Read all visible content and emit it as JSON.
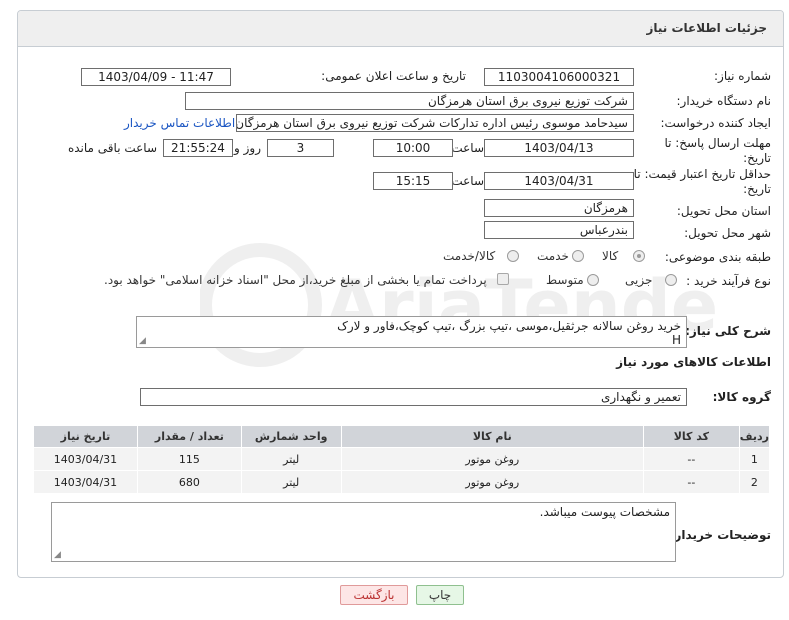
{
  "header": {
    "title": "جزئیات اطلاعات نیاز"
  },
  "fields": {
    "need_number_label": "شماره نیاز:",
    "need_number": "1103004106000321",
    "announce_label": "تاریخ و ساعت اعلان عمومی:",
    "announce_value": "1403/04/09 - 11:47",
    "buyer_label": "نام دستگاه خریدار:",
    "buyer_value": "شرکت توزیع نیروی برق استان هرمزگان",
    "creator_label": "ایجاد کننده درخواست:",
    "creator_value": "سیدحامد موسوی رئیس اداره تدارکات شرکت توزیع نیروی برق استان هرمزگان",
    "contact_link": "اطلاعات تماس خریدار",
    "reply_deadline_label": "مهلت ارسال پاسخ: تا تاریخ:",
    "reply_date": "1403/04/13",
    "time_label": "ساعت",
    "reply_time": "10:00",
    "days_value": "3",
    "days_label": "روز و",
    "remaining_time": "21:55:24",
    "remaining_label": "ساعت باقی مانده",
    "price_validity_label": "حداقل تاریخ اعتبار قیمت: تا تاریخ:",
    "price_date": "1403/04/31",
    "price_time": "15:15",
    "province_label": "استان محل تحویل:",
    "province_value": "هرمزگان",
    "city_label": "شهر محل تحویل:",
    "city_value": "بندرعباس",
    "category_label": "طبقه بندی موضوعی:",
    "category_options": [
      "کالا",
      "خدمت",
      "کالا/خدمت"
    ],
    "category_selected": "کالا",
    "process_label": "نوع فرآیند خرید :",
    "process_options": [
      "جزیی",
      "متوسط"
    ],
    "payment_note": "پرداخت تمام یا بخشی از مبلغ خرید،از محل \"اسناد خزانه اسلامی\" خواهد بود.",
    "description_label": "شرح کلی نیاز:",
    "description_value": "خرید روغن سالانه جرثقیل،موسی ،تیپ بزرگ ،تیپ کوچک،فاور و لارک",
    "description_marker": "H"
  },
  "goods": {
    "section_title": "اطلاعات کالاهای مورد نیاز",
    "group_label": "گروه کالا:",
    "group_value": "تعمیر و نگهداری",
    "columns": [
      "ردیف",
      "کد کالا",
      "نام کالا",
      "واحد شمارش",
      "تعداد / مقدار",
      "تاریخ نیاز"
    ],
    "rows": [
      {
        "row": "1",
        "code": "--",
        "name": "روغن موتور",
        "unit": "لیتر",
        "qty": "115",
        "date": "1403/04/31"
      },
      {
        "row": "2",
        "code": "--",
        "name": "روغن موتور",
        "unit": "لیتر",
        "qty": "680",
        "date": "1403/04/31"
      }
    ]
  },
  "buyer_notes": {
    "label": "توضیحات خریدار:",
    "value": "مشخصات پیوست میباشد."
  },
  "buttons": {
    "print": "چاپ",
    "back": "بازگشت"
  },
  "watermark_text": "AriaTender.net",
  "colors": {
    "link": "#1a55c2",
    "print_bg": "#e6f7e6",
    "back_bg": "#fde6e6"
  }
}
